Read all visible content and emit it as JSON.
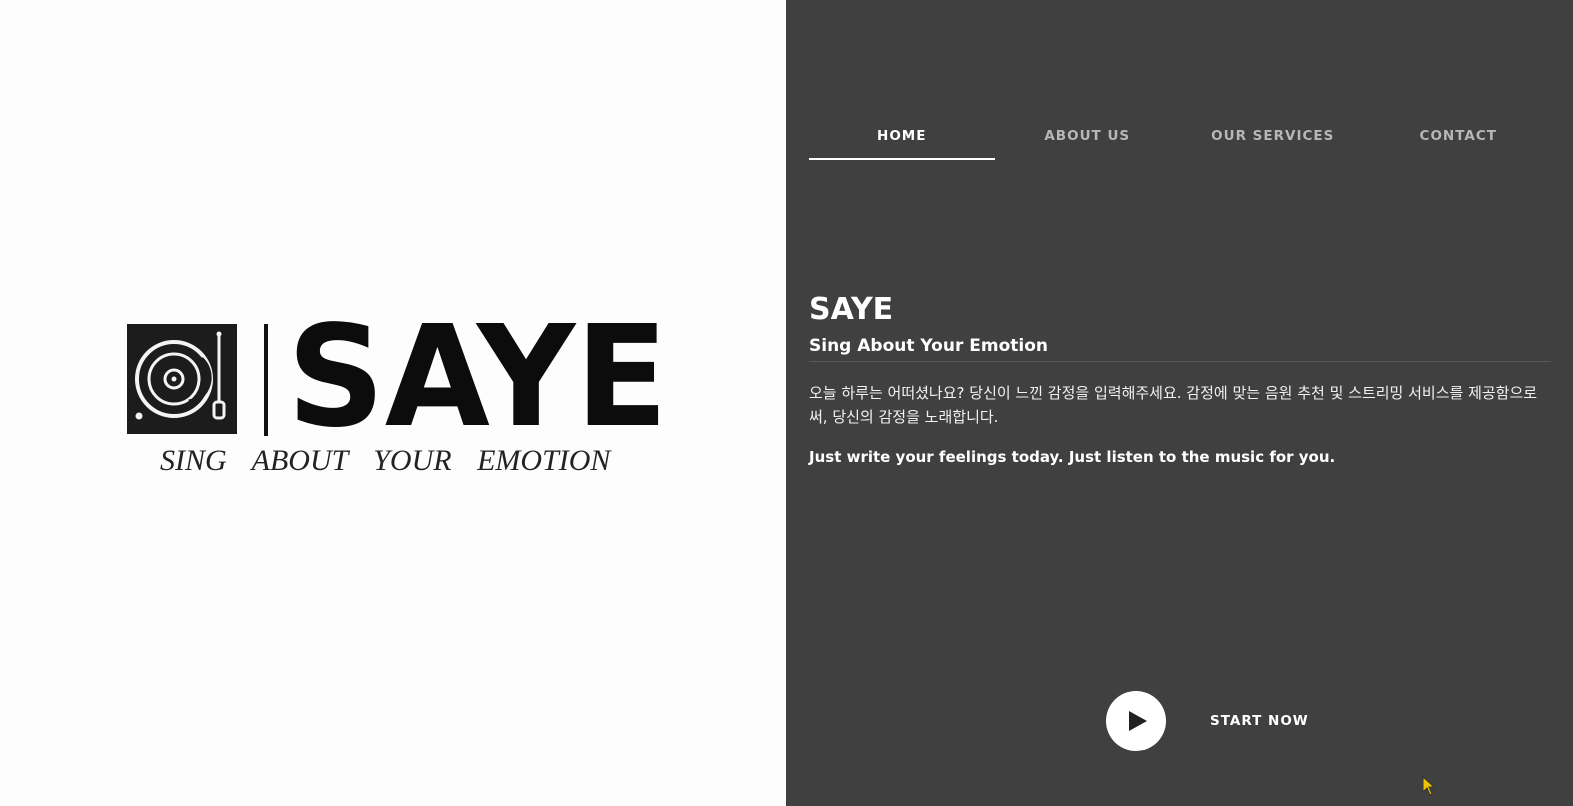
{
  "logo": {
    "word": "SAYE",
    "tagline": "SING ABOUT YOUR EMOTION",
    "icon": "turntable-icon"
  },
  "nav": {
    "items": [
      {
        "label": "HOME",
        "active": true
      },
      {
        "label": "ABOUT US",
        "active": false
      },
      {
        "label": "OUR SERVICES",
        "active": false
      },
      {
        "label": "CONTACT",
        "active": false
      }
    ]
  },
  "hero": {
    "title": "SAYE",
    "subtitle": "Sing About Your Emotion",
    "description_ko": "오늘 하루는 어떠셨나요? 당신이 느낀 감정을 입력해주세요. 감정에 맞는 음원 추천 및 스트리밍 서비스를 제공함으로써, 당신의 감정을 노래합니다.",
    "description_en": "Just write your feelings today. Just listen to the music for you."
  },
  "cta": {
    "play_icon": "play-icon",
    "label": "START NOW"
  },
  "colors": {
    "left_background": "#fdfdfd",
    "right_background": "#404040",
    "nav_inactive": "#b7b7b7",
    "text": "#ffffff",
    "cursor": "#f0c400"
  }
}
